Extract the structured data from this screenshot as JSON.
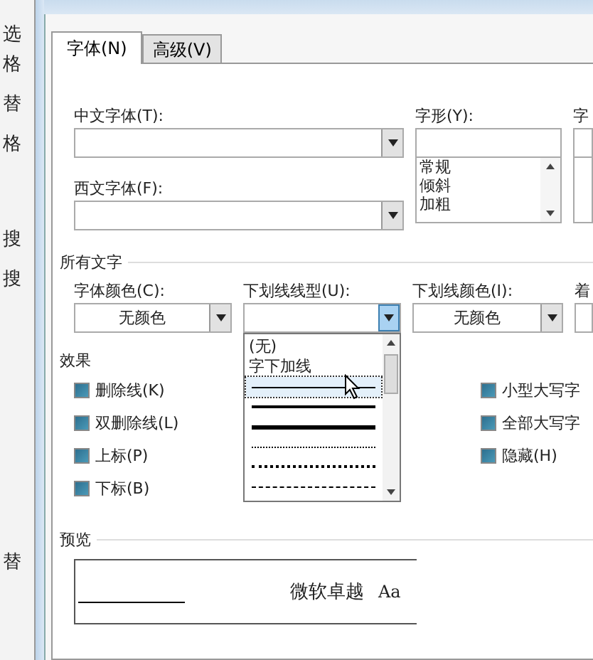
{
  "background_window": {
    "labels": [
      "选",
      "格",
      "替",
      "格",
      "搜",
      "搜",
      "替"
    ]
  },
  "tabs": [
    {
      "label": "字体(N)",
      "selected": true
    },
    {
      "label": "高级(V)",
      "selected": false
    }
  ],
  "font": {
    "chinese_font": {
      "label": "中文字体(T):"
    },
    "western_font": {
      "label": "西文字体(F):"
    },
    "style": {
      "label": "字形(Y):",
      "options": [
        {
          "label": "常规"
        },
        {
          "label": "倾斜"
        },
        {
          "label": "加粗"
        }
      ]
    },
    "column_3": {
      "label": "字"
    }
  },
  "all_text": {
    "heading": "所有文字",
    "font_color": {
      "label": "字体颜色(C):",
      "value": "无颜色"
    },
    "underline_style": {
      "label": "下划线线型(U):",
      "expanded": true,
      "options": [
        {
          "kind": "text",
          "label": "(无)",
          "selected": false
        },
        {
          "kind": "text",
          "label": "字下加线",
          "selected": false
        },
        {
          "kind": "line",
          "selected": true
        },
        {
          "kind": "line",
          "selected": false
        },
        {
          "kind": "line",
          "selected": false
        },
        {
          "kind": "line",
          "selected": false
        },
        {
          "kind": "line",
          "selected": false
        },
        {
          "kind": "line",
          "selected": false
        }
      ]
    },
    "underline_color": {
      "label": "下划线颜色(I):",
      "value": "无颜色"
    },
    "column_4": {
      "label": "着"
    }
  },
  "effects": {
    "heading": "效果",
    "left": [
      {
        "label": "删除线(K)",
        "indeterminate": true
      },
      {
        "label": "双删除线(L)",
        "indeterminate": true
      },
      {
        "label": "上标(P)",
        "indeterminate": true
      },
      {
        "label": "下标(B)",
        "indeterminate": true
      }
    ],
    "right": [
      {
        "label": "小型大写字",
        "indeterminate": true
      },
      {
        "label": "全部大写字",
        "indeterminate": true
      },
      {
        "label": "隐藏(H)",
        "indeterminate": true
      }
    ]
  },
  "preview": {
    "heading": "预览",
    "sample": "微软卓越",
    "sample_latin": "Aa"
  }
}
